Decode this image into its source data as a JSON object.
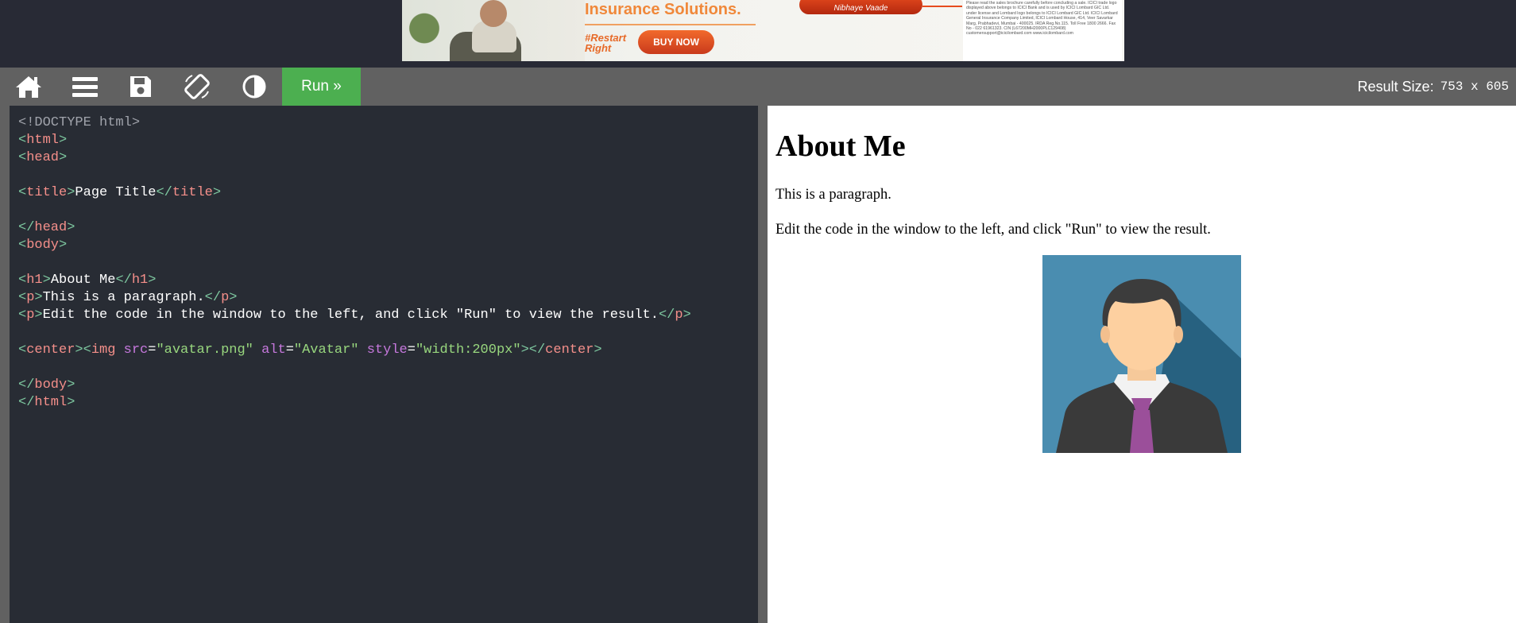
{
  "ad": {
    "headline": "Insurance Solutions.",
    "tagline": "#Restart Right",
    "cta": "BUY NOW",
    "brand": "Nibhaye Vaade",
    "fine_print": "Please read the sales brochure carefully before concluding a sale. ICICI trade logo displayed above belongs to ICICI Bank and is used by ICICI Lombard GIC Ltd. under license and Lombard logo belongs to ICICI Lombard GIC Ltd. ICICI Lombard General Insurance Company Limited, ICICI Lombard House, 414, Veer Savarkar Marg, Prabhadevi, Mumbai - 400025. IRDA Reg.No.115. Toll Free 1800 2666. Fax No - 022 61961323. CIN (L67200MH2000PLC129408) customersupport@icicilombard.com www.icicilombard.com"
  },
  "toolbar": {
    "home_icon": "home-icon",
    "menu_icon": "menu-icon",
    "save_icon": "save-icon",
    "rotate_icon": "rotate-icon",
    "theme_icon": "contrast-icon",
    "run_label": "Run »",
    "result_size_label": "Result Size:",
    "result_size_value": "753 x 605"
  },
  "editor": {
    "lines": [
      [
        {
          "t": "<!DOCTYPE html>",
          "c": "doc"
        }
      ],
      [
        {
          "t": "<",
          "c": "br"
        },
        {
          "t": "html",
          "c": "tag"
        },
        {
          "t": ">",
          "c": "br"
        }
      ],
      [
        {
          "t": "<",
          "c": "br"
        },
        {
          "t": "head",
          "c": "tag"
        },
        {
          "t": ">",
          "c": "br"
        }
      ],
      [],
      [
        {
          "t": "<",
          "c": "br"
        },
        {
          "t": "title",
          "c": "tag"
        },
        {
          "t": ">",
          "c": "br"
        },
        {
          "t": "Page Title",
          "c": "txt"
        },
        {
          "t": "</",
          "c": "br"
        },
        {
          "t": "title",
          "c": "tag"
        },
        {
          "t": ">",
          "c": "br"
        }
      ],
      [],
      [
        {
          "t": "</",
          "c": "br"
        },
        {
          "t": "head",
          "c": "tag"
        },
        {
          "t": ">",
          "c": "br"
        }
      ],
      [
        {
          "t": "<",
          "c": "br"
        },
        {
          "t": "body",
          "c": "tag"
        },
        {
          "t": ">",
          "c": "br"
        }
      ],
      [],
      [
        {
          "t": "<",
          "c": "br"
        },
        {
          "t": "h1",
          "c": "tag"
        },
        {
          "t": ">",
          "c": "br"
        },
        {
          "t": "About Me",
          "c": "txt"
        },
        {
          "t": "</",
          "c": "br"
        },
        {
          "t": "h1",
          "c": "tag"
        },
        {
          "t": ">",
          "c": "br"
        }
      ],
      [
        {
          "t": "<",
          "c": "br"
        },
        {
          "t": "p",
          "c": "tag"
        },
        {
          "t": ">",
          "c": "br"
        },
        {
          "t": "This is a paragraph.",
          "c": "txt"
        },
        {
          "t": "</",
          "c": "br"
        },
        {
          "t": "p",
          "c": "tag"
        },
        {
          "t": ">",
          "c": "br"
        }
      ],
      [
        {
          "t": "<",
          "c": "br"
        },
        {
          "t": "p",
          "c": "tag"
        },
        {
          "t": ">",
          "c": "br"
        },
        {
          "t": "Edit the code in the window to the left, and click \"Run\" to view the result.",
          "c": "txt"
        },
        {
          "t": "</",
          "c": "br"
        },
        {
          "t": "p",
          "c": "tag"
        },
        {
          "t": ">",
          "c": "br"
        }
      ],
      [],
      [
        {
          "t": "<",
          "c": "br"
        },
        {
          "t": "center",
          "c": "tag"
        },
        {
          "t": "><",
          "c": "br"
        },
        {
          "t": "img",
          "c": "tag"
        },
        {
          "t": " src",
          "c": "attr"
        },
        {
          "t": "=",
          "c": "txt"
        },
        {
          "t": "\"avatar.png\"",
          "c": "val"
        },
        {
          "t": " alt",
          "c": "attr"
        },
        {
          "t": "=",
          "c": "txt"
        },
        {
          "t": "\"Avatar\"",
          "c": "val"
        },
        {
          "t": " style",
          "c": "attr"
        },
        {
          "t": "=",
          "c": "txt"
        },
        {
          "t": "\"width:200px\"",
          "c": "val"
        },
        {
          "t": "></",
          "c": "br"
        },
        {
          "t": "center",
          "c": "tag"
        },
        {
          "t": ">",
          "c": "br"
        }
      ],
      [],
      [
        {
          "t": "</",
          "c": "br"
        },
        {
          "t": "body",
          "c": "tag"
        },
        {
          "t": ">",
          "c": "br"
        }
      ],
      [
        {
          "t": "</",
          "c": "br"
        },
        {
          "t": "html",
          "c": "tag"
        },
        {
          "t": ">",
          "c": "br"
        }
      ]
    ]
  },
  "result": {
    "heading": "About Me",
    "paragraph1": "This is a paragraph.",
    "paragraph2": "Edit the code in the window to the left, and click \"Run\" to view the result.",
    "avatar_icon": "avatar-icon"
  },
  "colors": {
    "background": "#282a35",
    "toolbar": "#616161",
    "run_button": "#4caf50",
    "editor_bg": "#282c34",
    "tag": "#f48f8a",
    "bracket": "#7ec8a0",
    "attr": "#c678dd",
    "value": "#98d77e"
  }
}
